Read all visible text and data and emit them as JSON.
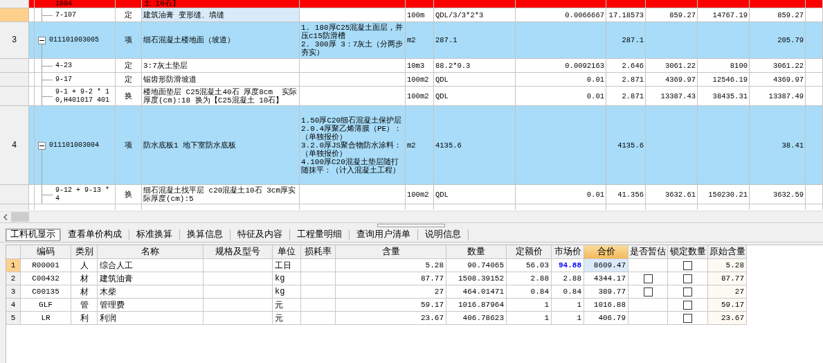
{
  "upper_grid": {
    "rows": [
      {
        "kind": "cut",
        "number": "",
        "selected": false,
        "name_focused": false,
        "cells": [
          "1004",
          "",
          "土 10石】",
          "",
          "",
          "",
          "",
          "",
          "",
          "",
          ""
        ]
      },
      {
        "kind": "quota",
        "number": "",
        "selected": true,
        "name_focused": true,
        "cells": [
          "7-107",
          "定",
          "建筑油膏 变形缝、填缝",
          "",
          "100m",
          "QDL/3/3*2*3",
          "0.0066667",
          "17.18573",
          "859.27",
          "14767.19",
          "859.27"
        ]
      },
      {
        "kind": "item",
        "number": "3",
        "selected": false,
        "name_focused": false,
        "expanded": true,
        "cells": [
          "011101003005",
          "项",
          "细石混凝土楼地面（坡道）",
          "1. 180厚C25混凝土面层，并压c15防滑槽\n2. 300厚 3：7灰土（分两步夯实）",
          "m2",
          "287.1",
          "",
          "287.1",
          "",
          "",
          "205.79"
        ]
      },
      {
        "kind": "quota",
        "number": "",
        "selected": false,
        "name_focused": false,
        "cells": [
          "4-23",
          "定",
          "3:7灰土垫层",
          "",
          "10m3",
          "88.2*0.3",
          "0.0092163",
          "2.646",
          "3061.22",
          "8100",
          "3061.22"
        ]
      },
      {
        "kind": "quota",
        "number": "",
        "selected": false,
        "name_focused": false,
        "cells": [
          "9-17",
          "定",
          "锯齿形防滑坡道",
          "",
          "100m2",
          "QDL",
          "0.01",
          "2.871",
          "4369.97",
          "12546.19",
          "4369.97"
        ]
      },
      {
        "kind": "quota",
        "number": "",
        "selected": false,
        "name_focused": false,
        "cells": [
          "9-1 + 9-2 * 10,H401017 401",
          "换",
          "楼地面垫层 C25混凝土40石 厚度8cm  实际厚度(cm):18 换为【C25混凝土 10石】",
          "",
          "100m2",
          "QDL",
          "0.01",
          "2.871",
          "13387.43",
          "38435.31",
          "13387.49"
        ]
      },
      {
        "kind": "item",
        "number": "4",
        "selected": false,
        "name_focused": false,
        "expanded": true,
        "cells": [
          "011101003004",
          "项",
          "防水底板1 地下室防水底板",
          "1.50厚C20细石混凝土保护层\n2.0.4厚聚乙烯薄膜（PE）：（单独报价）\n3.2.0厚JS聚合物防水涂料：（单独报价）\n4.100厚C20混凝土垫层随打随抹平：（计入混凝土工程）",
          "m2",
          "4135.6",
          "",
          "4135.6",
          "",
          "",
          "38.41"
        ]
      },
      {
        "kind": "quota",
        "number": "",
        "selected": false,
        "name_focused": false,
        "cells": [
          "9-12 + 9-13 * 4",
          "换",
          "细石混凝土找平层 c20混凝土10石 3cm厚实际厚度(cm):5",
          "",
          "100m2",
          "QDL",
          "0.01",
          "41.356",
          "3632.61",
          "150230.21",
          "3632.59"
        ]
      }
    ]
  },
  "tabs": [
    {
      "label": "工料机显示",
      "selected": true
    },
    {
      "label": "查看单价构成",
      "selected": false
    },
    {
      "label": "标准换算",
      "selected": false
    },
    {
      "label": "换算信息",
      "selected": false
    },
    {
      "label": "特征及内容",
      "selected": false
    },
    {
      "label": "工程量明细",
      "selected": false
    },
    {
      "label": "查询用户清单",
      "selected": false
    },
    {
      "label": "说明信息",
      "selected": false
    }
  ],
  "lower_grid": {
    "columns": [
      {
        "label": "编码",
        "selected": false
      },
      {
        "label": "类别",
        "selected": false
      },
      {
        "label": "名称",
        "selected": false
      },
      {
        "label": "规格及型号",
        "selected": false
      },
      {
        "label": "单位",
        "selected": false
      },
      {
        "label": "损耗率",
        "selected": false
      },
      {
        "label": "含量",
        "selected": false
      },
      {
        "label": "数量",
        "selected": false
      },
      {
        "label": "定额价",
        "selected": false
      },
      {
        "label": "市场价",
        "selected": false
      },
      {
        "label": "合价",
        "selected": true
      },
      {
        "label": "是否暂估",
        "selected": false
      },
      {
        "label": "锁定数量",
        "selected": false
      },
      {
        "label": "原始含量",
        "selected": false
      }
    ],
    "rows": [
      {
        "number": "1",
        "selected": true,
        "code": "R00001",
        "category": "人",
        "name": "综合人工",
        "unit": "工日",
        "content": "5.28",
        "quantity": "90.74065",
        "quota_price": "56.03",
        "market_price": "94.88",
        "price_changed": true,
        "total": "8609.47",
        "locked": false,
        "original_content": "5.28"
      },
      {
        "number": "2",
        "selected": false,
        "code": "C00432",
        "category": "材",
        "name": "建筑油膏",
        "unit": "kg",
        "content": "87.77",
        "quantity": "1508.39152",
        "quota_price": "2.88",
        "market_price": "2.88",
        "price_changed": false,
        "total": "4344.17",
        "provisional": false,
        "locked": false,
        "original_content": "87.77"
      },
      {
        "number": "3",
        "selected": false,
        "code": "C00135",
        "category": "材",
        "name": "木柴",
        "unit": "kg",
        "content": "27",
        "quantity": "464.01471",
        "quota_price": "0.84",
        "market_price": "0.84",
        "price_changed": false,
        "total": "389.77",
        "provisional": false,
        "locked": false,
        "original_content": "27"
      },
      {
        "number": "4",
        "selected": false,
        "code": "GLF",
        "category": "管",
        "name": "管理费",
        "unit": "元",
        "content": "59.17",
        "quantity": "1016.87964",
        "quota_price": "1",
        "market_price": "1",
        "price_changed": false,
        "total": "1016.88",
        "locked": false,
        "original_content": "59.17"
      },
      {
        "number": "5",
        "selected": false,
        "code": "LR",
        "category": "利",
        "name": "利润",
        "unit": "元",
        "content": "23.67",
        "quantity": "406.78623",
        "quota_price": "1",
        "market_price": "1",
        "price_changed": false,
        "total": "406.79",
        "locked": false,
        "original_content": "23.67"
      }
    ]
  }
}
